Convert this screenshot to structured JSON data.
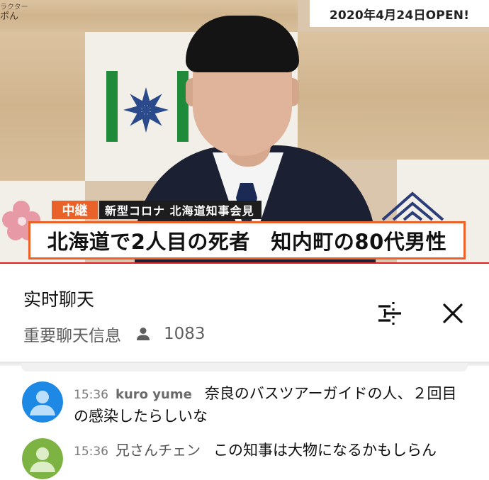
{
  "video": {
    "top_left_text_1": "ラクター",
    "top_left_text_2": "ポん",
    "open_banner": "2020年4月24日OPEN!",
    "live_tag": "中継",
    "subcaption": "新型コロナ 北海道知事会見",
    "headline": "北海道で2人目の死者　知内町の80代男性",
    "progress_percent": 100,
    "colors": {
      "caption_accent": "#e8622a",
      "progress": "#e02020"
    }
  },
  "chat": {
    "title": "实时聊天",
    "mode": "重要聊天信息",
    "viewer_icon": "person-icon",
    "viewer_count": "1083",
    "filter_icon": "sliders-icon",
    "close_icon": "close-icon"
  },
  "messages": [
    {
      "time": "15:36",
      "author": "kuro yume",
      "text": "奈良のバスツアーガイドの人、２回目の感染したらしいな",
      "avatar_color": "#1e88e5"
    },
    {
      "time": "15:36",
      "author": "兄さんチェン",
      "text": "この知事は大物になるかもしらん",
      "avatar_color": "#7cb342"
    }
  ]
}
